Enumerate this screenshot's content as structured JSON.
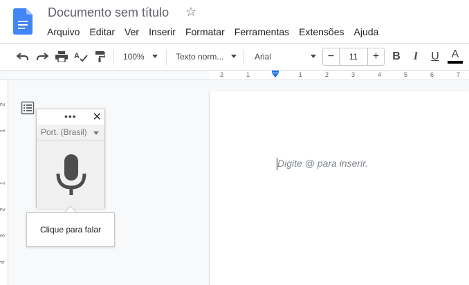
{
  "document": {
    "title": "Documento sem título"
  },
  "menu": [
    "Arquivo",
    "Editar",
    "Ver",
    "Inserir",
    "Formatar",
    "Ferramentas",
    "Extensões",
    "Ajuda"
  ],
  "toolbar": {
    "zoom": "100%",
    "style": "Texto norm...",
    "font": "Arial",
    "font_size": "11",
    "minus": "−",
    "plus": "+",
    "bold": "B",
    "italic": "I",
    "underline": "U",
    "text_color_letter": "A",
    "text_color": "#000000"
  },
  "ruler": {
    "horizontal": [
      "2",
      "1",
      "1",
      "2",
      "3",
      "4",
      "5",
      "6",
      "7"
    ],
    "vertical": [
      "2",
      "1",
      "1",
      "2",
      "3",
      "4"
    ]
  },
  "editor": {
    "placeholder": "Digite @ para inserir."
  },
  "voice_typing": {
    "language": "Port. (Brasil)",
    "menu_dots": "•••",
    "close": "✕",
    "tooltip": "Clique para falar"
  },
  "colors": {
    "accent": "#1a73e8",
    "mic": "#4d4d4d"
  }
}
